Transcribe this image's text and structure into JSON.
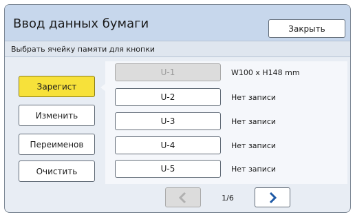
{
  "dialog": {
    "title": "Ввод данных бумаги",
    "close_label": "Закрыть",
    "subtitle": "Выбрать ячейку памяти для кнопки"
  },
  "actions": [
    {
      "label": "Зарегист",
      "active": true
    },
    {
      "label": "Изменить",
      "active": false
    },
    {
      "label": "Переименов",
      "active": false
    },
    {
      "label": "Очистить",
      "active": false
    }
  ],
  "slots": [
    {
      "label": "U-1",
      "desc": "W100 x H148 mm",
      "disabled": true
    },
    {
      "label": "U-2",
      "desc": "Нет записи",
      "disabled": false
    },
    {
      "label": "U-3",
      "desc": "Нет записи",
      "disabled": false
    },
    {
      "label": "U-4",
      "desc": "Нет записи",
      "disabled": false
    },
    {
      "label": "U-5",
      "desc": "Нет записи",
      "disabled": false
    }
  ],
  "pager": {
    "indicator": "1/6",
    "prev_icon": "chevron-left-icon",
    "next_icon": "chevron-right-icon"
  },
  "colors": {
    "header_bg": "#c7d7ec",
    "active_button": "#f7e13a",
    "chevron_active": "#1f5aa6",
    "chevron_disabled": "#b0b0b0"
  }
}
